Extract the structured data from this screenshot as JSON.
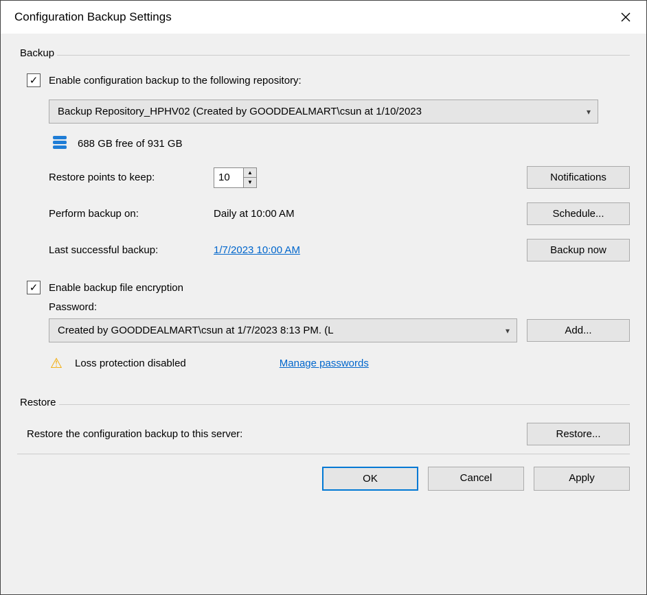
{
  "window": {
    "title": "Configuration Backup Settings"
  },
  "backup": {
    "group_label": "Backup",
    "enable_label": "Enable configuration backup to the following repository:",
    "repo_selected": "Backup Repository_HPHV02 (Created by GOODDEALMART\\csun at 1/10/2023",
    "free_space": "688 GB free of 931 GB",
    "restore_points_label": "Restore points to keep:",
    "restore_points_value": "10",
    "perform_label": "Perform backup on:",
    "perform_value": "Daily at 10:00 AM",
    "last_label": "Last successful backup:",
    "last_value": "1/7/2023 10:00 AM",
    "notifications_btn": "Notifications",
    "schedule_btn": "Schedule...",
    "backup_now_btn": "Backup now",
    "encrypt_label": "Enable backup file encryption",
    "password_label": "Password:",
    "password_selected": "Created by GOODDEALMART\\csun at 1/7/2023 8:13 PM. (L",
    "add_btn": "Add...",
    "loss_label": "Loss protection disabled",
    "manage_label": "Manage passwords"
  },
  "restore": {
    "group_label": "Restore",
    "text": "Restore the configuration backup to this server:",
    "restore_btn": "Restore..."
  },
  "footer": {
    "ok": "OK",
    "cancel": "Cancel",
    "apply": "Apply"
  }
}
